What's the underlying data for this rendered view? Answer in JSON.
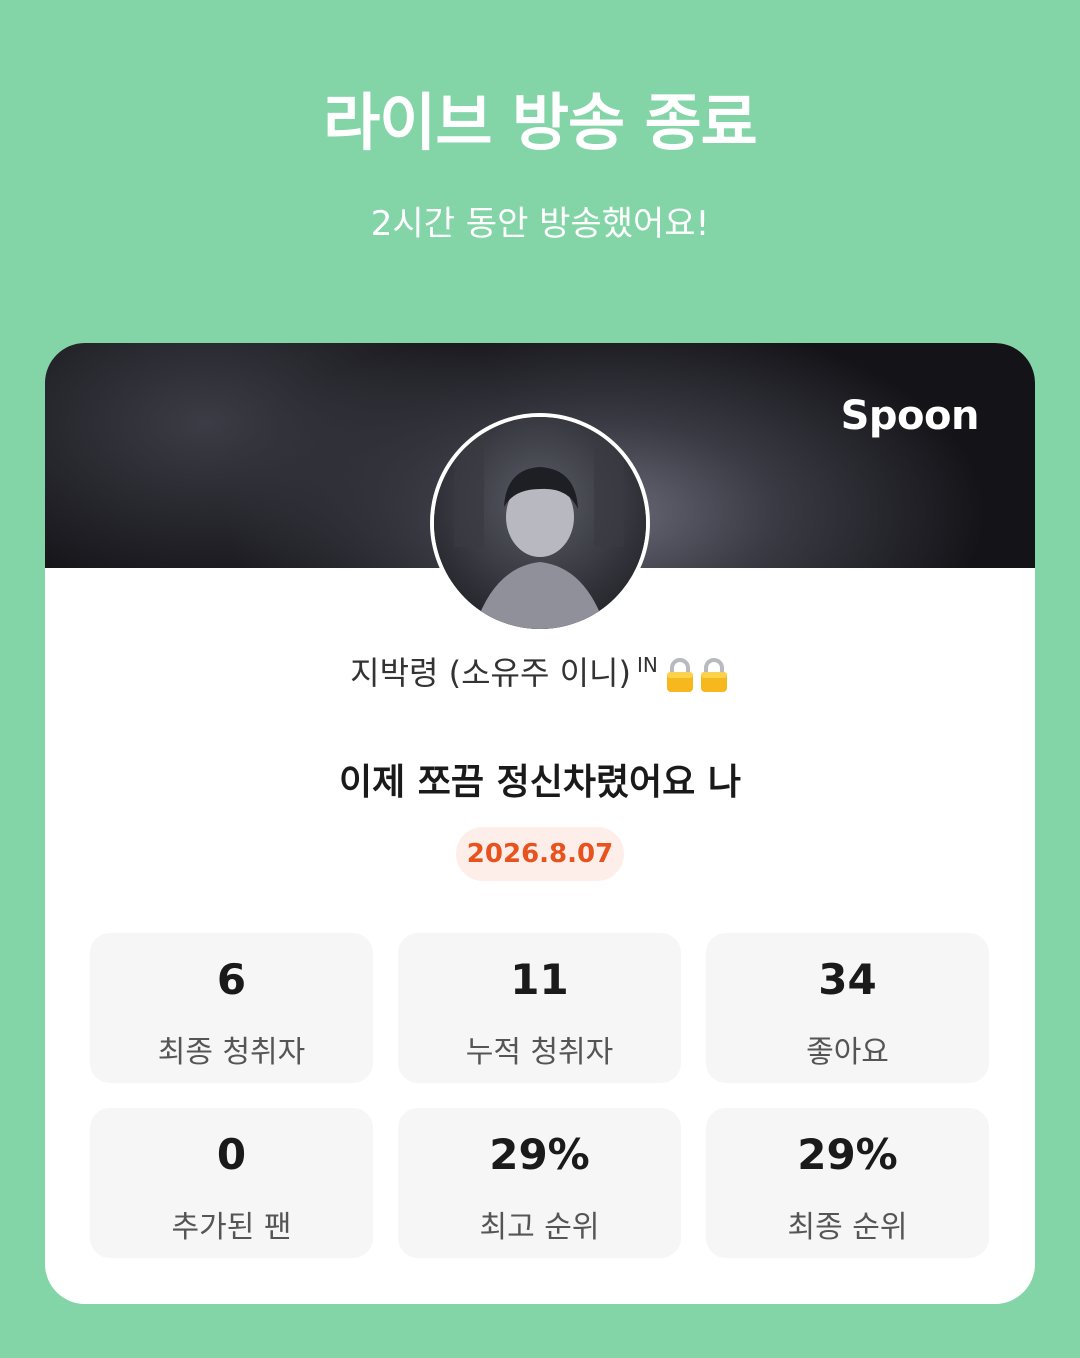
{
  "header": {
    "title": "라이브 방송 종료",
    "subtitle": "2시간 동안 방송했어요!"
  },
  "card": {
    "brand": "Spoon",
    "host_name": "지박령 (소유주 이니)",
    "host_badge": "IN",
    "host_icons": [
      "lock-icon",
      "lock-icon"
    ],
    "live_title": "이제 쪼끔 정신차렸어요 나",
    "date": "2026.8.07",
    "stats": [
      {
        "value": "6",
        "label": "최종 청취자"
      },
      {
        "value": "11",
        "label": "누적 청취자"
      },
      {
        "value": "34",
        "label": "좋아요"
      },
      {
        "value": "0",
        "label": "추가된 팬"
      },
      {
        "value": "29%",
        "label": "최고 순위"
      },
      {
        "value": "29%",
        "label": "최종 순위"
      }
    ]
  },
  "colors": {
    "background": "#83d5a8",
    "accent": "#e8521f",
    "date_pill_bg": "#fdeee9"
  }
}
